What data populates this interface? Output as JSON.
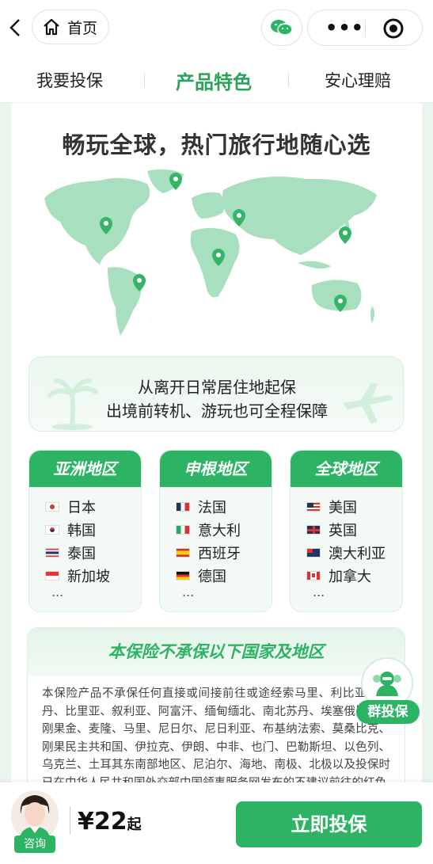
{
  "nav": {
    "home_label": "首页"
  },
  "tabs": [
    {
      "label": "我要投保"
    },
    {
      "label": "产品特色"
    },
    {
      "label": "安心理赔"
    }
  ],
  "feature": {
    "title": "畅玩全球，热门旅行地随心选",
    "start_line1": "从离开日常居住地起保",
    "start_line2": "出境前转机、游玩也可全程保障"
  },
  "regions": [
    {
      "title": "亚洲地区",
      "countries": [
        "日本",
        "韩国",
        "泰国",
        "新加坡"
      ],
      "more": "..."
    },
    {
      "title": "申根地区",
      "countries": [
        "法国",
        "意大利",
        "西班牙",
        "德国"
      ],
      "more": "..."
    },
    {
      "title": "全球地区",
      "countries": [
        "美国",
        "英国",
        "澳大利亚",
        "加拿大"
      ],
      "more": "..."
    }
  ],
  "exclusion": {
    "title": "本保险不承保以下国家及地区",
    "text": "本保险产品不承保任何直接或间接前往或途经索马里、利比亚、苏丹、比里亚、叙利亚、阿富汗、缅甸缅北、南北苏丹、埃塞俄比亚、刚果金、麦隆、马里、尼日尔、尼日利亚、布基纳法索、莫桑比克、刚果民主共和国、伊拉克、伊朗、中非、也门、巴勒斯坦、以色列、乌克兰、土耳其东南部地区、尼泊尔、海地、南极、北极以及投保时已在中华人民共和国外交部中国领事服务网发布的不建议前往的红色"
  },
  "group_insure": {
    "label": "群投保"
  },
  "bottom": {
    "consult_label": "咨询",
    "price": "¥22",
    "price_suffix": "起",
    "buy_label": "立即投保"
  },
  "colors": {
    "accent": "#2cb464",
    "map": "#a8e0bf",
    "pin": "#35b46a"
  }
}
